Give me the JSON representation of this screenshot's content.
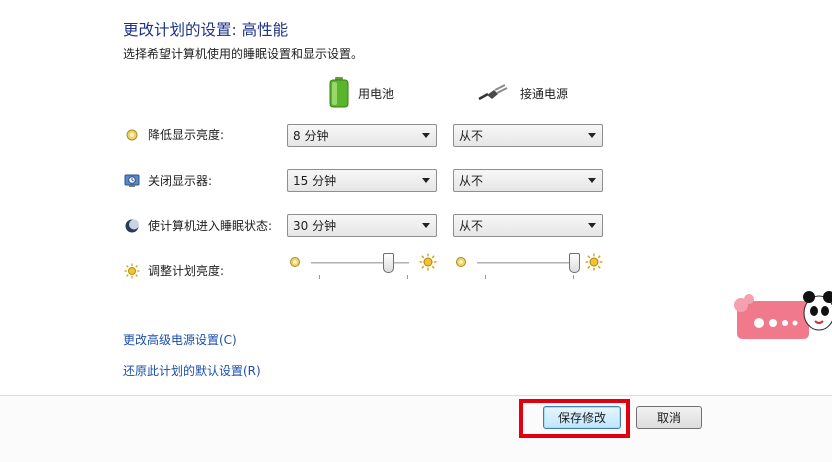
{
  "header": {
    "title": "更改计划的设置: 高性能",
    "subtitle": "选择希望计算机使用的睡眠设置和显示设置。"
  },
  "columns": {
    "battery": {
      "label": "用电池",
      "icon": "battery-icon"
    },
    "plugged_in": {
      "label": "接通电源",
      "icon": "power-plug-icon"
    }
  },
  "settings": [
    {
      "label": "降低显示亮度:",
      "icon": "dim-brightness-icon",
      "battery": "8 分钟",
      "plugged_in": "从不"
    },
    {
      "label": "关闭显示器:",
      "icon": "monitor-clock-icon",
      "battery": "15 分钟",
      "plugged_in": "从不"
    },
    {
      "label": "使计算机进入睡眠状态:",
      "icon": "moon-sleep-icon",
      "battery": "30 分钟",
      "plugged_in": "从不"
    }
  ],
  "brightness": {
    "label": "调整计划亮度:",
    "icon": "brightness-sun-icon",
    "battery_level": 0.8,
    "plugged_in_level": 1.0
  },
  "links": {
    "advanced": "更改高级电源设置(C)",
    "restore": "还原此计划的默认设置(R)"
  },
  "buttons": {
    "save": "保存修改",
    "cancel": "取消"
  },
  "colors": {
    "title": "#1e3287",
    "link": "#1a4fa8",
    "highlight": "#e0000f",
    "sticker": "#f07a8c"
  }
}
